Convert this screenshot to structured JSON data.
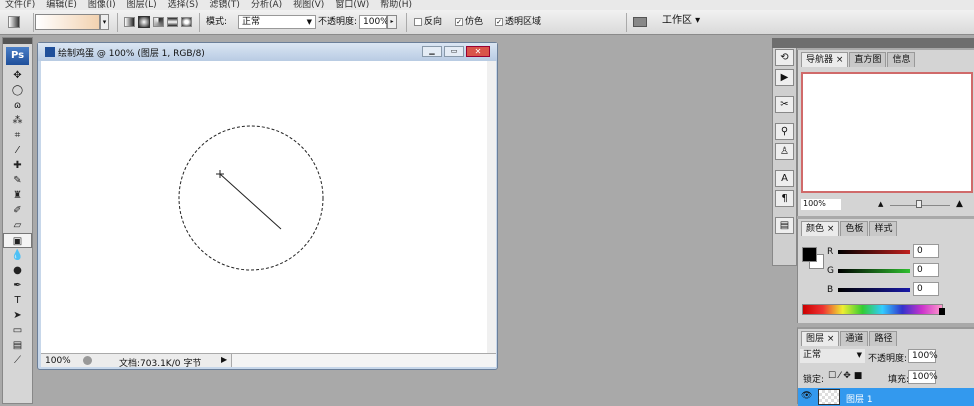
{
  "menu": [
    "文件(F)",
    "编辑(E)",
    "图像(I)",
    "图层(L)",
    "选择(S)",
    "滤镜(T)",
    "分析(A)",
    "视图(V)",
    "窗口(W)",
    "帮助(H)"
  ],
  "options": {
    "mode_label": "模式:",
    "mode_value": "正常",
    "opacity_label": "不透明度:",
    "opacity_value": "100%",
    "reverse_label": "反向",
    "dither_label": "仿色",
    "transparency_label": "透明区域",
    "workspace_label": "工作区 ▾"
  },
  "toolbox": {
    "logo": "Ps",
    "tools": [
      "move",
      "marquee",
      "lasso",
      "magic-wand",
      "crop",
      "slice",
      "healing",
      "brush",
      "stamp",
      "history-brush",
      "eraser",
      "gradient",
      "blur",
      "dodge",
      "pen",
      "type",
      "path-select",
      "shape",
      "notes",
      "eyedropper"
    ]
  },
  "document": {
    "title": "绘制鸡蛋 @ 100% (图层 1, RGB/8)",
    "zoom": "100%",
    "doc_info": "文档:703.1K/0 字节"
  },
  "navigator": {
    "tabs": [
      "导航器",
      "直方图",
      "信息"
    ],
    "zoom": "100%"
  },
  "color": {
    "tabs": [
      "颜色",
      "色板",
      "样式"
    ],
    "r_label": "R",
    "g_label": "G",
    "b_label": "B",
    "r": "0",
    "g": "0",
    "b": "0",
    "accent_r": "#c0201e",
    "accent_g": "#2fbf2f",
    "accent_b": "#1a1aa8"
  },
  "layers": {
    "tabs": [
      "图层",
      "通道",
      "路径"
    ],
    "blend": "正常",
    "opacity_label": "不透明度:",
    "opacity": "100%",
    "lock_label": "锁定:",
    "fill_label": "填充:",
    "fill": "100%",
    "layer_name": "图层 1",
    "selection_color": "#3399ee"
  }
}
